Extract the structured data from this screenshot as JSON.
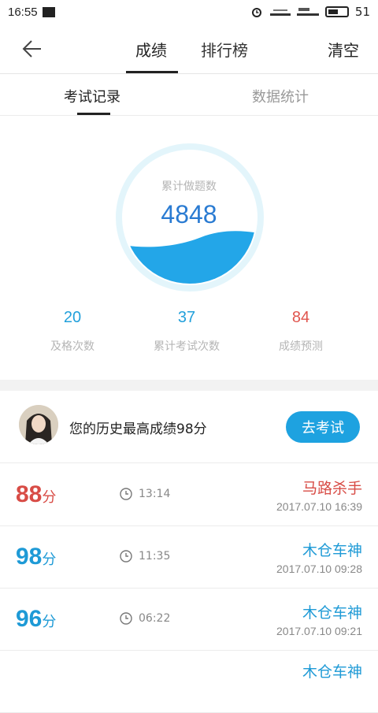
{
  "status_bar": {
    "time": "16:55",
    "battery": "51"
  },
  "nav": {
    "tabs": [
      "成绩",
      "排行榜"
    ],
    "active_tab": "成绩",
    "clear_label": "清空"
  },
  "subtabs": [
    "考试记录",
    "数据统计"
  ],
  "gauge": {
    "label": "累计做题数",
    "value": "4848",
    "fill_percent": 35,
    "colors": {
      "ring": "#e3f5fb",
      "water": "#23a6e8"
    }
  },
  "stats": [
    {
      "value": "20",
      "label": "及格次数",
      "color": "#22a0db"
    },
    {
      "value": "37",
      "label": "累计考试次数",
      "color": "#22a0db"
    },
    {
      "value": "84",
      "label": "成绩预测",
      "color": "#e0554e"
    }
  ],
  "best": {
    "text": "您的历史最高成绩98分",
    "button": "去考试"
  },
  "records": [
    {
      "score": "88",
      "unit": "分",
      "duration": "13:14",
      "title": "马路杀手",
      "date": "2017.07.10  16:39",
      "color": "#d84c46"
    },
    {
      "score": "98",
      "unit": "分",
      "duration": "11:35",
      "title": "木仓车神",
      "date": "2017.07.10  09:28",
      "color": "#1e9ad6"
    },
    {
      "score": "96",
      "unit": "分",
      "duration": "06:22",
      "title": "木仓车神",
      "date": "2017.07.10  09:21",
      "color": "#1e9ad6"
    },
    {
      "score": "",
      "unit": "",
      "duration": "",
      "title": "木仓车神",
      "date": "",
      "color": "#1e9ad6"
    }
  ]
}
